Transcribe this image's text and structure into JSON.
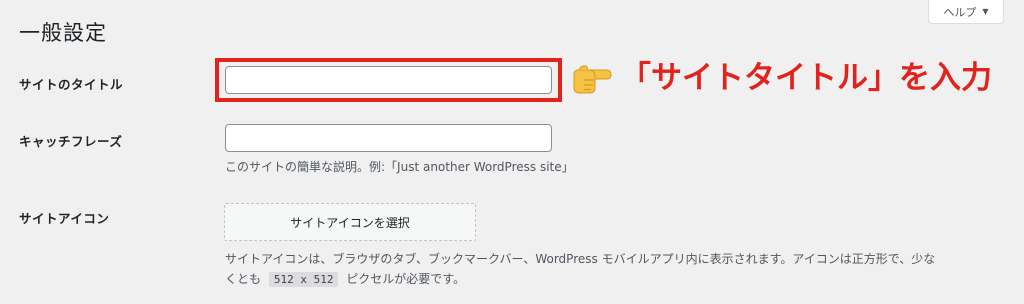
{
  "header": {
    "help_label": "ヘルプ",
    "help_caret": "▼",
    "page_title": "一般設定"
  },
  "site_title": {
    "label": "サイトのタイトル",
    "value": "",
    "placeholder": ""
  },
  "tagline": {
    "label": "キャッチフレーズ",
    "value": "",
    "placeholder": "",
    "description": "このサイトの簡単な説明。例:「Just another WordPress site」"
  },
  "site_icon": {
    "label": "サイトアイコン",
    "button_label": "サイトアイコンを選択",
    "description_line1": "サイトアイコンは、ブラウザのタブ、ブックマークバー、WordPress モバイルアプリ内に表示されます。アイコンは正方形で、少な",
    "description_line2_prefix": "くとも",
    "description_size": "512 x 512",
    "description_line2_suffix": "ピクセルが必要です。"
  },
  "annotation": {
    "callout_text": "「サイトタイトル」を入力",
    "pointer_icon": "pointing-right-hand-icon",
    "accent_color": "#e0231c"
  }
}
